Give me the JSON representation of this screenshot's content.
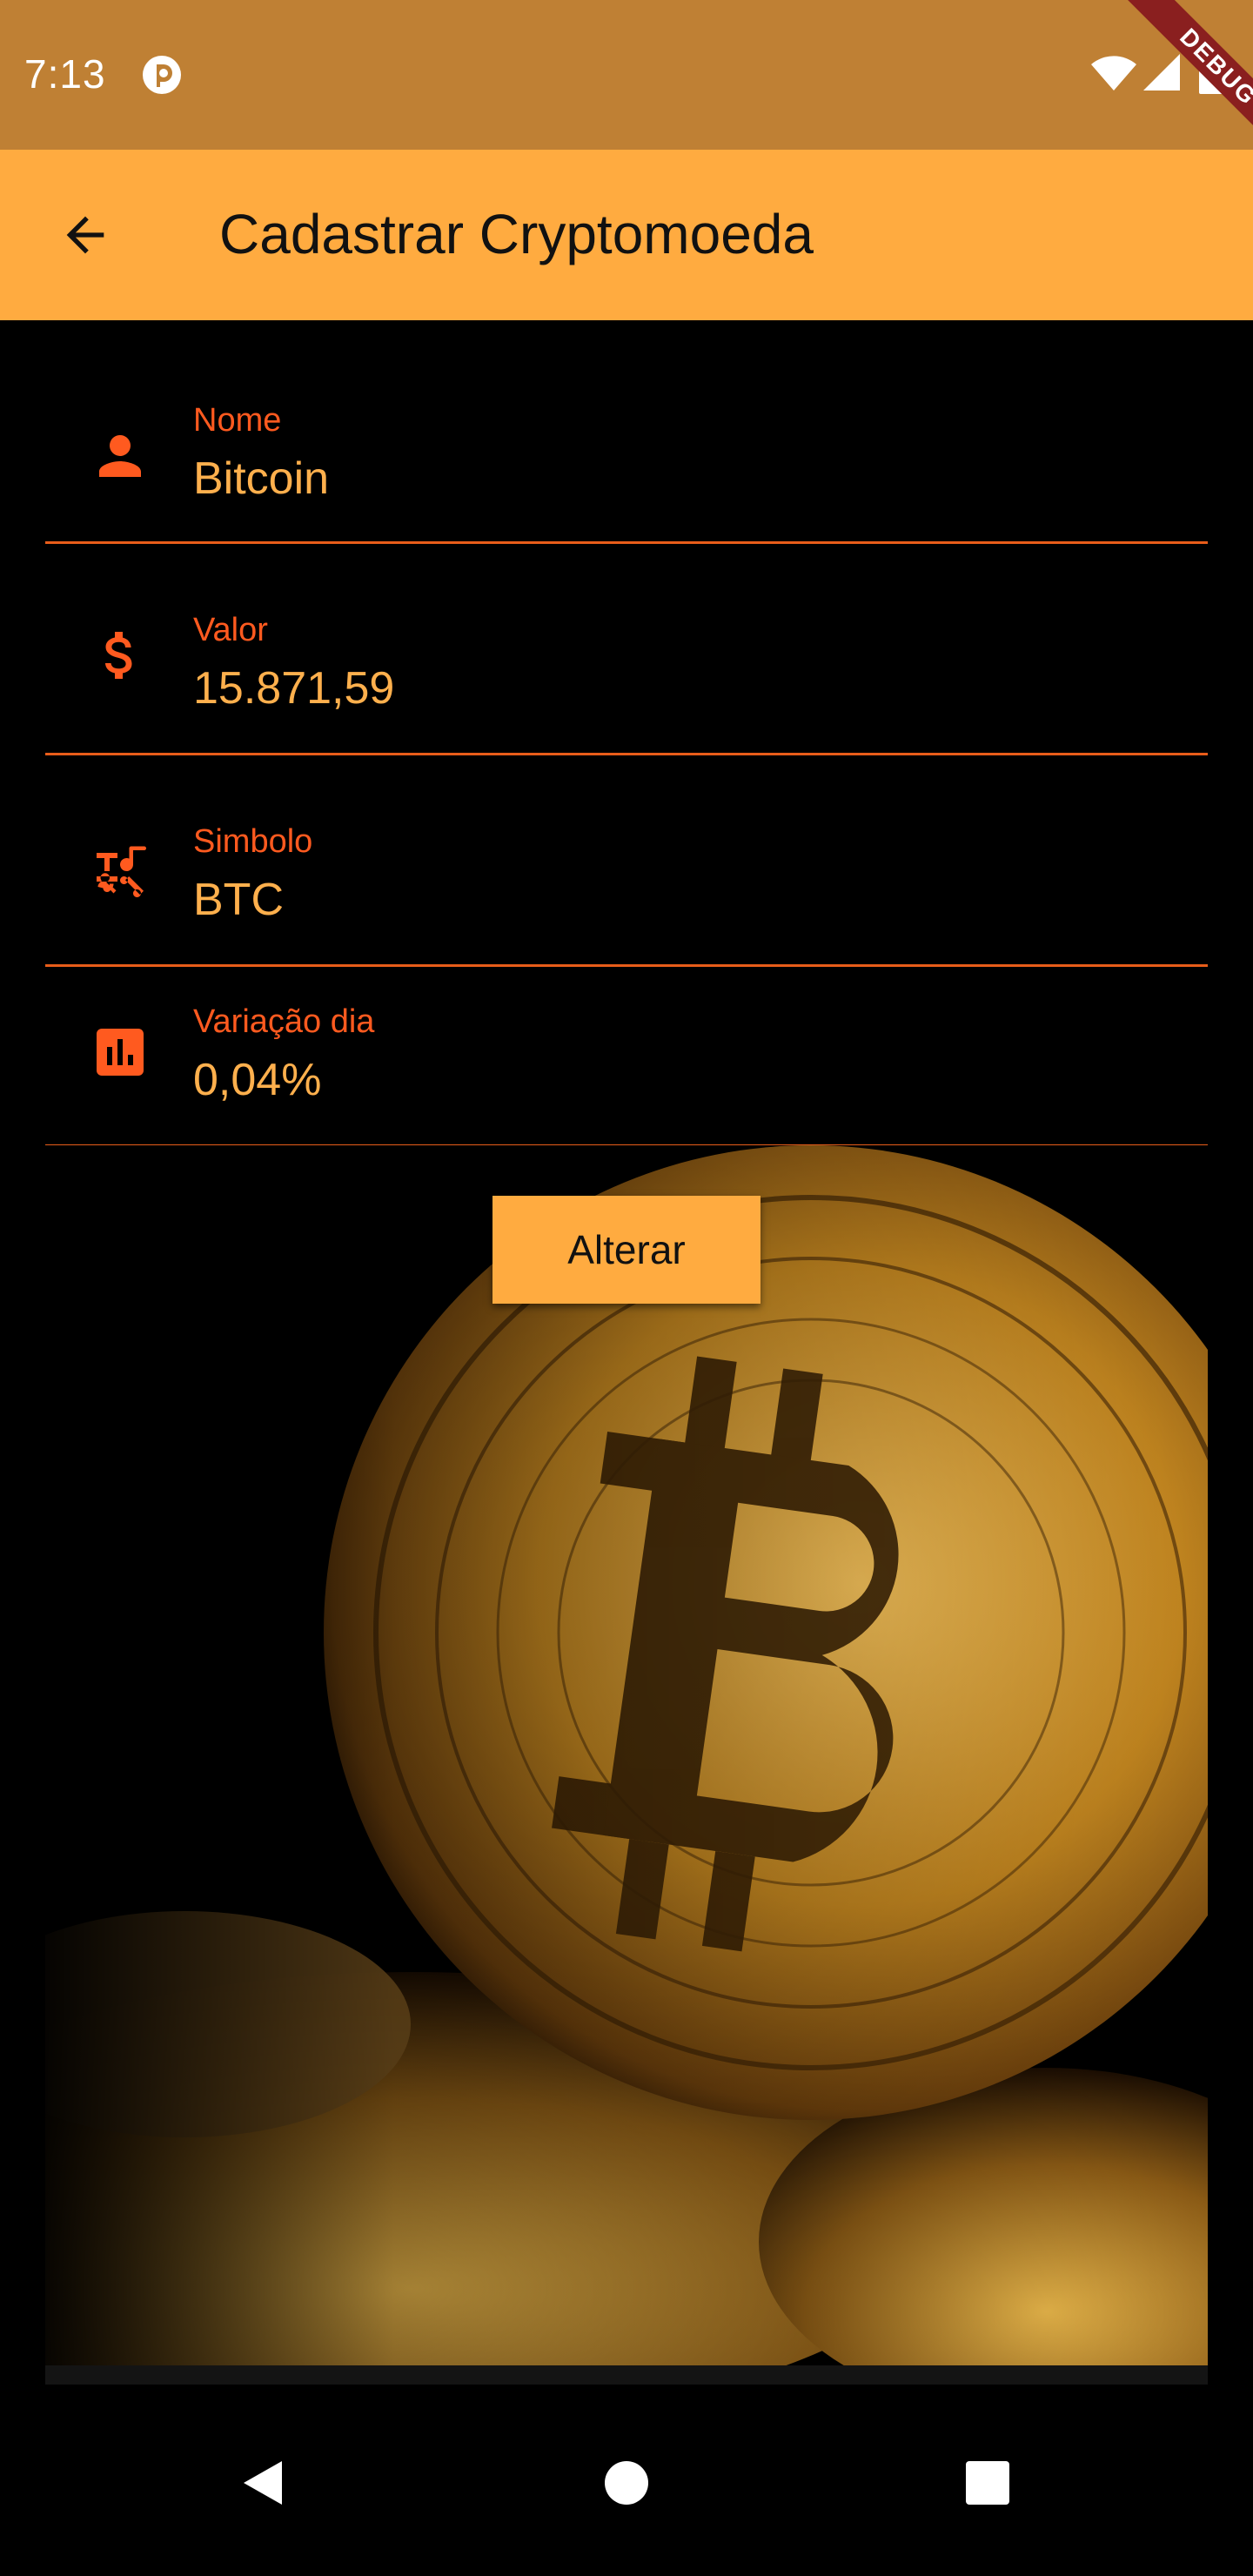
{
  "status_bar": {
    "time": "7:13",
    "debug_label": "DEBUG",
    "icons": [
      "app-notification-icon",
      "wifi-icon",
      "signal-icon",
      "battery-icon"
    ]
  },
  "app_bar": {
    "title": "Cadastrar Cryptomoeda",
    "back_icon": "arrow-back-icon"
  },
  "form": {
    "fields": [
      {
        "label": "Nome",
        "value": "Bitcoin",
        "icon": "person-icon"
      },
      {
        "label": "Valor",
        "value": "15.871,59",
        "icon": "dollar-icon"
      },
      {
        "label": "Simbolo",
        "value": "BTC",
        "icon": "symbols-icon"
      },
      {
        "label": "Variação dia",
        "value": "0,04%",
        "icon": "bar-chart-icon"
      }
    ],
    "submit_label": "Alterar"
  },
  "image": {
    "subject": "bitcoin-coin-image"
  },
  "nav_bar": {
    "icons": [
      "nav-back-icon",
      "nav-home-icon",
      "nav-recents-icon"
    ]
  },
  "colors": {
    "status_bar": "#bf8034",
    "app_bar": "#ffab40",
    "accent": "#ff5a1f",
    "value_text": "#ffb04d",
    "background": "#000000"
  }
}
